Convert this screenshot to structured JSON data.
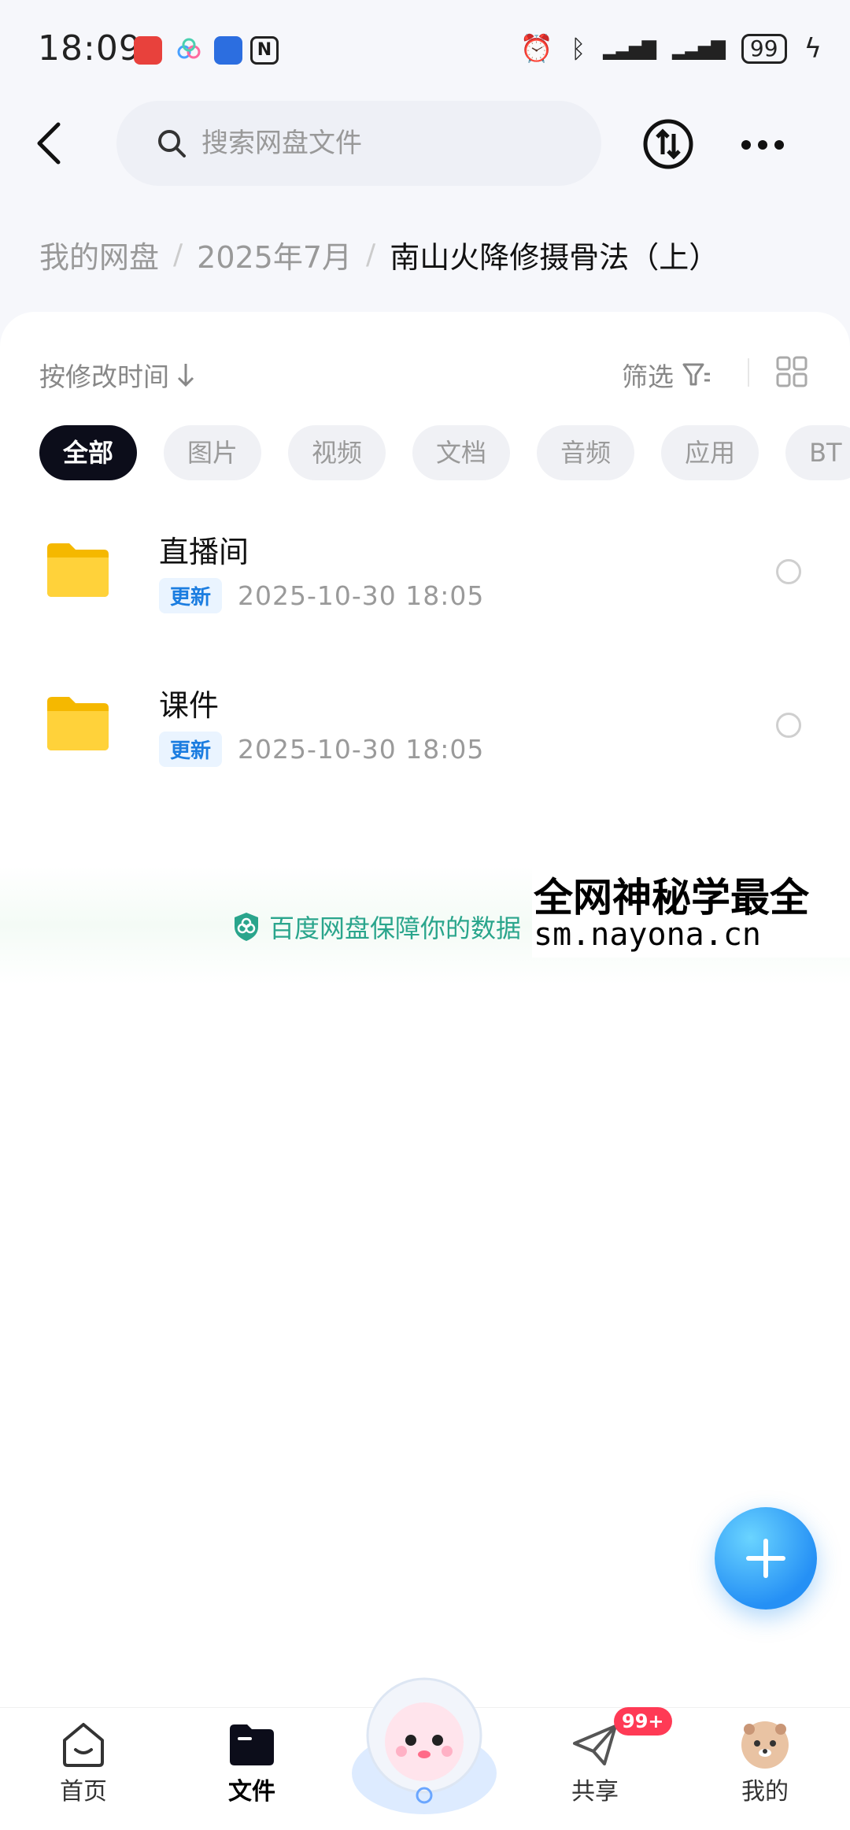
{
  "status_bar": {
    "time": "18:09",
    "battery": "99"
  },
  "search": {
    "placeholder": "搜索网盘文件"
  },
  "breadcrumb": {
    "items": [
      "我的网盘",
      "2025年7月"
    ],
    "current": "南山火降修摄骨法（上）"
  },
  "toolbar": {
    "sort_label": "按修改时间",
    "filter_label": "筛选"
  },
  "chips": [
    "全部",
    "图片",
    "视频",
    "文档",
    "音频",
    "应用",
    "BT"
  ],
  "files": [
    {
      "name": "直播间",
      "badge": "更新",
      "time": "2025-10-30  18:05"
    },
    {
      "name": "课件",
      "badge": "更新",
      "time": "2025-10-30  18:05"
    }
  ],
  "protect_banner": {
    "text": "百度网盘保障你的数据"
  },
  "watermark": {
    "line1": "全网神秘学最全",
    "line2": "sm.nayona.cn"
  },
  "bottom_nav": {
    "home": "首页",
    "files": "文件",
    "share": "共享",
    "share_badge": "99+",
    "me": "我的"
  },
  "colors": {
    "accent": "#1b7de0",
    "protect": "#2aa58c",
    "badge": "#ff3a55",
    "fab": "#2590f5"
  }
}
